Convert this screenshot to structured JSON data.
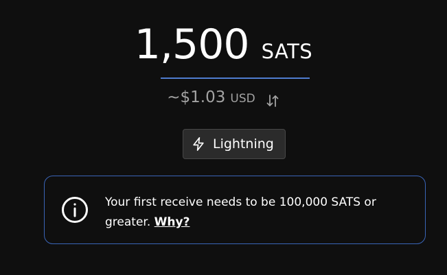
{
  "amount": {
    "value": "1,500",
    "unit": "SATS",
    "underline_color": "#4f7dd0"
  },
  "fiat": {
    "value": "~$1.03",
    "currency": "USD",
    "swap_icon": "swap-vertical-arrows-icon"
  },
  "receive_method": {
    "icon": "lightning-bolt-icon",
    "label": "Lightning"
  },
  "notice": {
    "icon": "info-circle-icon",
    "message": "Your first receive needs to be 100,000 SATS or greater.",
    "link_label": "Why?",
    "border_color": "#3a65b8"
  }
}
